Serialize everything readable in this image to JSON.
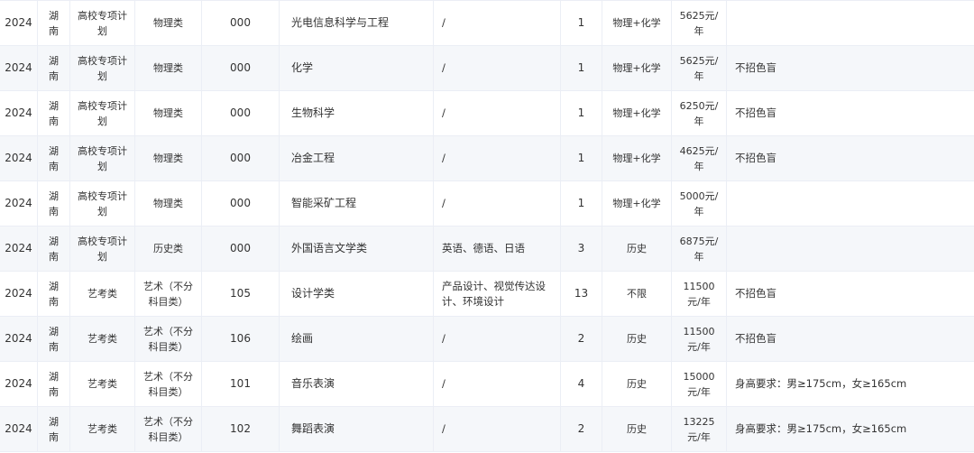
{
  "rows": [
    {
      "year": "2024",
      "province": "湖南",
      "batch": "高校专项计划",
      "category": "物理类",
      "code": "000",
      "major": "光电信息科学与工程",
      "direction": "/",
      "count": "1",
      "subjects": "物理+化学",
      "fee": "5625元/年",
      "note": ""
    },
    {
      "year": "2024",
      "province": "湖南",
      "batch": "高校专项计划",
      "category": "物理类",
      "code": "000",
      "major": "化学",
      "direction": "/",
      "count": "1",
      "subjects": "物理+化学",
      "fee": "5625元/年",
      "note": "不招色盲"
    },
    {
      "year": "2024",
      "province": "湖南",
      "batch": "高校专项计划",
      "category": "物理类",
      "code": "000",
      "major": "生物科学",
      "direction": "/",
      "count": "1",
      "subjects": "物理+化学",
      "fee": "6250元/年",
      "note": "不招色盲"
    },
    {
      "year": "2024",
      "province": "湖南",
      "batch": "高校专项计划",
      "category": "物理类",
      "code": "000",
      "major": "冶金工程",
      "direction": "/",
      "count": "1",
      "subjects": "物理+化学",
      "fee": "4625元/年",
      "note": "不招色盲"
    },
    {
      "year": "2024",
      "province": "湖南",
      "batch": "高校专项计划",
      "category": "物理类",
      "code": "000",
      "major": "智能采矿工程",
      "direction": "/",
      "count": "1",
      "subjects": "物理+化学",
      "fee": "5000元/年",
      "note": ""
    },
    {
      "year": "2024",
      "province": "湖南",
      "batch": "高校专项计划",
      "category": "历史类",
      "code": "000",
      "major": "外国语言文学类",
      "direction": "英语、德语、日语",
      "count": "3",
      "subjects": "历史",
      "fee": "6875元/年",
      "note": ""
    },
    {
      "year": "2024",
      "province": "湖南",
      "batch": "艺考类",
      "category": "艺术（不分科目类）",
      "code": "105",
      "major": "设计学类",
      "direction": "产品设计、视觉传达设计、环境设计",
      "count": "13",
      "subjects": "不限",
      "fee": "11500元/年",
      "note": "不招色盲"
    },
    {
      "year": "2024",
      "province": "湖南",
      "batch": "艺考类",
      "category": "艺术（不分科目类）",
      "code": "106",
      "major": "绘画",
      "direction": "/",
      "count": "2",
      "subjects": "历史",
      "fee": "11500元/年",
      "note": "不招色盲"
    },
    {
      "year": "2024",
      "province": "湖南",
      "batch": "艺考类",
      "category": "艺术（不分科目类）",
      "code": "101",
      "major": "音乐表演",
      "direction": "/",
      "count": "4",
      "subjects": "历史",
      "fee": "15000元/年",
      "note": "身高要求：男≥175cm，女≥165cm"
    },
    {
      "year": "2024",
      "province": "湖南",
      "batch": "艺考类",
      "category": "艺术（不分科目类）",
      "code": "102",
      "major": "舞蹈表演",
      "direction": "/",
      "count": "2",
      "subjects": "历史",
      "fee": "13225元/年",
      "note": "身高要求：男≥175cm，女≥165cm"
    }
  ]
}
